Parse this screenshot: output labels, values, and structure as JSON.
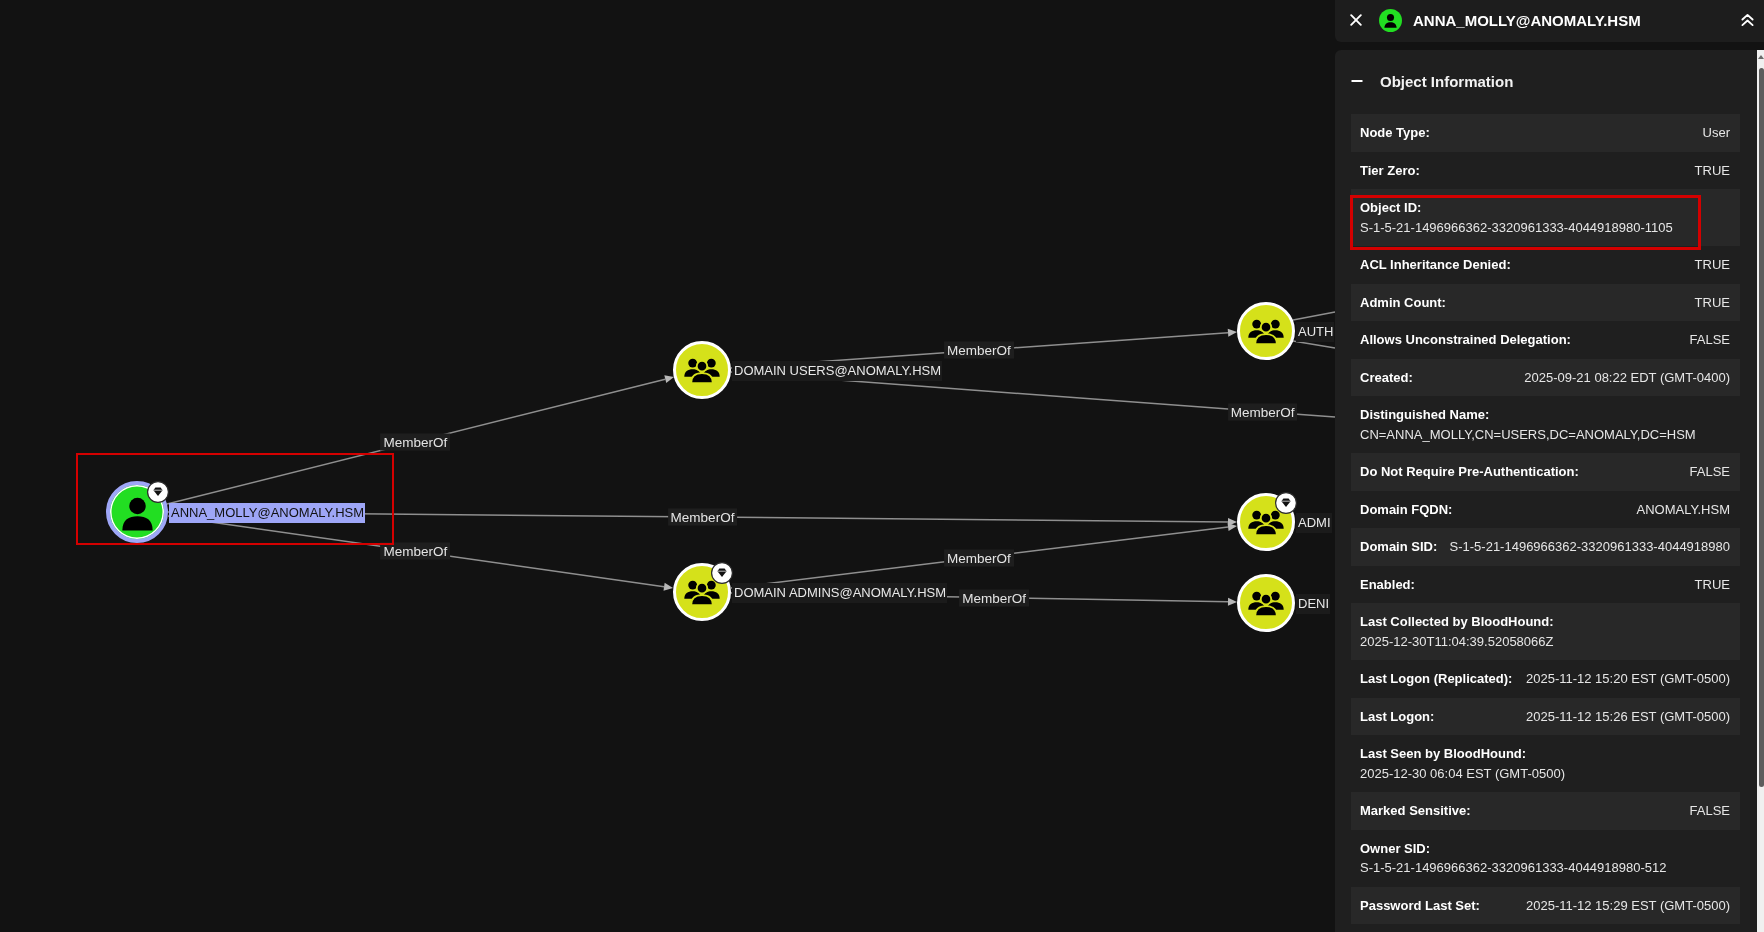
{
  "graph": {
    "nodes": [
      {
        "kind": "user",
        "label": "ANNA_MOLLY@ANOMALY.HSM",
        "color": "#22de22",
        "selected": true,
        "badge": true,
        "highlighted": true
      },
      {
        "kind": "group",
        "label": "DOMAIN USERS@ANOMALY.HSM",
        "color": "#d5e11a",
        "selected": false,
        "badge": false,
        "highlighted": false
      },
      {
        "kind": "group",
        "label": "DOMAIN ADMINS@ANOMALY.HSM",
        "color": "#d5e11a",
        "selected": false,
        "badge": true,
        "highlighted": false
      },
      {
        "kind": "group",
        "label": "AUTH",
        "color": "#d5e11a",
        "selected": false,
        "badge": false,
        "highlighted": false
      },
      {
        "kind": "group",
        "label": "ADMI",
        "color": "#d5e11a",
        "selected": false,
        "badge": true,
        "highlighted": false
      },
      {
        "kind": "group",
        "label": "DENI",
        "color": "#d5e11a",
        "selected": false,
        "badge": false,
        "highlighted": false
      }
    ],
    "edges": [
      {
        "kind": "labeled",
        "label": "MemberOf"
      },
      {
        "kind": "labeled",
        "label": "MemberOf"
      },
      {
        "kind": "labeled",
        "label": "MemberOf"
      },
      {
        "kind": "labeled",
        "label": "MemberOf"
      },
      {
        "kind": "labeled",
        "label": "MemberOf"
      },
      {
        "kind": "labeled",
        "label": "MemberOf"
      },
      {
        "kind": "labeled",
        "label": "MemberOf"
      },
      {
        "kind": "plain"
      },
      {
        "kind": "plain"
      }
    ]
  },
  "panel": {
    "header": {
      "kind": "user",
      "title": "ANNA_MOLLY@ANOMALY.HSM"
    },
    "section": {
      "title": "Object Information",
      "expanded": true
    },
    "properties": [
      {
        "kind": "inline",
        "label": "Node Type:",
        "value": "User",
        "highlighted": false
      },
      {
        "kind": "inline",
        "label": "Tier Zero:",
        "value": "TRUE",
        "highlighted": false
      },
      {
        "kind": "stacked",
        "label": "Object ID:",
        "value": "S-1-5-21-1496966362-3320961333-4044918980-1105",
        "highlighted": true
      },
      {
        "kind": "inline",
        "label": "ACL Inheritance Denied:",
        "value": "TRUE",
        "highlighted": false
      },
      {
        "kind": "inline",
        "label": "Admin Count:",
        "value": "TRUE",
        "highlighted": false
      },
      {
        "kind": "inline",
        "label": "Allows Unconstrained Delegation:",
        "value": "FALSE",
        "highlighted": false
      },
      {
        "kind": "inline",
        "label": "Created:",
        "value": "2025-09-21 08:22 EDT (GMT-0400)",
        "highlighted": false
      },
      {
        "kind": "stacked",
        "label": "Distinguished Name:",
        "value": "CN=ANNA_MOLLY,CN=USERS,DC=ANOMALY,DC=HSM",
        "highlighted": false
      },
      {
        "kind": "inline",
        "label": "Do Not Require Pre-Authentication:",
        "value": "FALSE",
        "highlighted": false
      },
      {
        "kind": "inline",
        "label": "Domain FQDN:",
        "value": "ANOMALY.HSM",
        "highlighted": false
      },
      {
        "kind": "inline",
        "label": "Domain SID:",
        "value": "S-1-5-21-1496966362-3320961333-4044918980",
        "highlighted": false
      },
      {
        "kind": "inline",
        "label": "Enabled:",
        "value": "TRUE",
        "highlighted": false
      },
      {
        "kind": "stacked",
        "label": "Last Collected by BloodHound:",
        "value": "2025-12-30T11:04:39.52058066Z",
        "highlighted": false
      },
      {
        "kind": "inline",
        "label": "Last Logon (Replicated):",
        "value": "2025-11-12 15:20 EST (GMT-0500)",
        "highlighted": false
      },
      {
        "kind": "inline",
        "label": "Last Logon:",
        "value": "2025-11-12 15:26 EST (GMT-0500)",
        "highlighted": false
      },
      {
        "kind": "stacked",
        "label": "Last Seen by BloodHound:",
        "value": "2025-12-30 06:04 EST (GMT-0500)",
        "highlighted": false
      },
      {
        "kind": "inline",
        "label": "Marked Sensitive:",
        "value": "FALSE",
        "highlighted": false
      },
      {
        "kind": "stacked",
        "label": "Owner SID:",
        "value": "S-1-5-21-1496966362-3320961333-4044918980-512",
        "highlighted": false
      },
      {
        "kind": "inline",
        "label": "Password Last Set:",
        "value": "2025-11-12 15:29 EST (GMT-0500)",
        "highlighted": false
      }
    ]
  }
}
